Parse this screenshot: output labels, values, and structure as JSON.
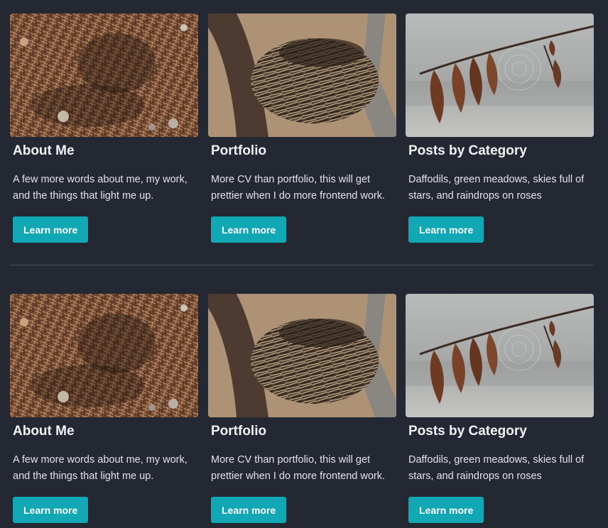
{
  "sections": [
    {
      "cards": [
        {
          "title": "About Me",
          "description": "A few more words about me, my work, and the things that light me up.",
          "button_label": "Learn more",
          "image": "ground-nest-photo"
        },
        {
          "title": "Portfolio",
          "description": "More CV than portfolio, this will get prettier when I do more frontend work.",
          "button_label": "Learn more",
          "image": "tree-nest-photo"
        },
        {
          "title": "Posts by Category",
          "description": "Daffodils, green meadows, skies full of stars, and raindrops on roses",
          "button_label": "Learn more",
          "image": "dry-leaves-cobweb-photo"
        }
      ]
    },
    {
      "cards": [
        {
          "title": "About Me",
          "description": "A few more words about me, my work, and the things that light me up.",
          "button_label": "Learn more",
          "image": "ground-nest-photo"
        },
        {
          "title": "Portfolio",
          "description": "More CV than portfolio, this will get prettier when I do more frontend work.",
          "button_label": "Learn more",
          "image": "tree-nest-photo"
        },
        {
          "title": "Posts by Category",
          "description": "Daffodils, green meadows, skies full of stars, and raindrops on roses",
          "button_label": "Learn more",
          "image": "dry-leaves-cobweb-photo"
        }
      ]
    }
  ],
  "colors": {
    "background": "#242833",
    "button": "#11a7b4",
    "divider": "#4a4f5b"
  }
}
